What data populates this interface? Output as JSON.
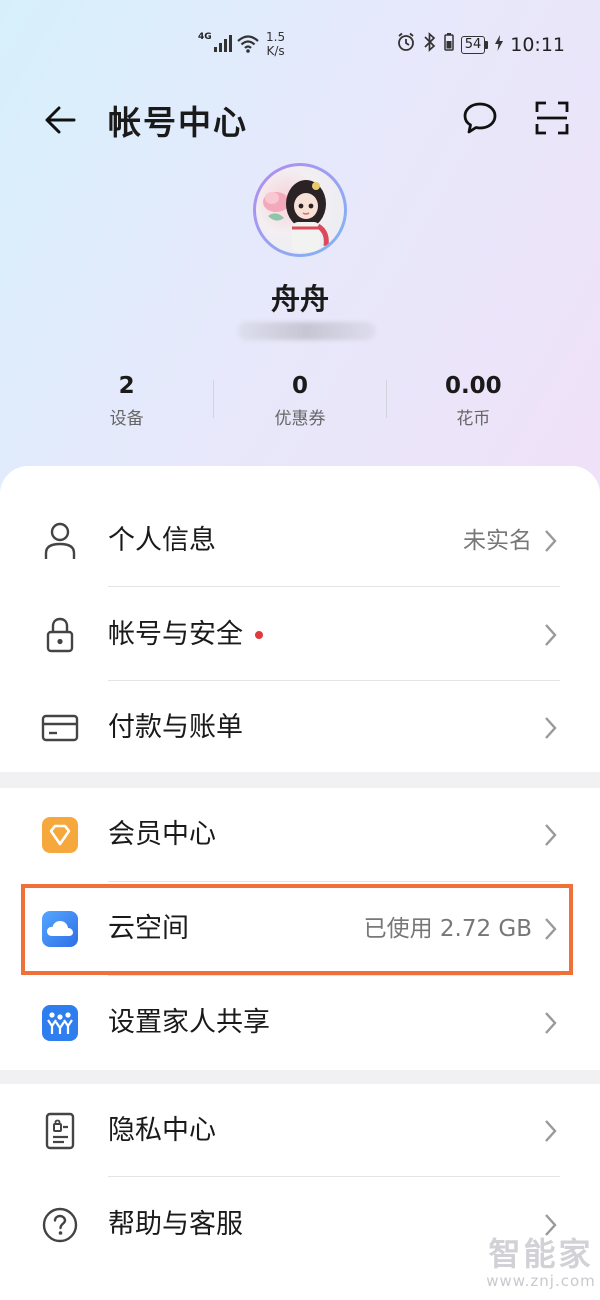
{
  "status_bar": {
    "network": "4G",
    "speed_value": "1.5",
    "speed_unit": "K/s",
    "battery": "54",
    "time": "10:11"
  },
  "header": {
    "title": "帐号中心",
    "icons": [
      "back-arrow-icon",
      "message-icon",
      "scan-icon"
    ]
  },
  "profile": {
    "name": "舟舟",
    "phone": "",
    "stats": [
      {
        "value": "2",
        "label": "设备"
      },
      {
        "value": "0",
        "label": "优惠券"
      },
      {
        "value": "0.00",
        "label": "花币"
      }
    ]
  },
  "sections": [
    {
      "items": [
        {
          "label": "个人信息",
          "value": "未实名",
          "icon": "person-icon"
        },
        {
          "label": "帐号与安全",
          "value": "",
          "icon": "lock-icon",
          "badge_color": "#e03a3a"
        },
        {
          "label": "付款与账单",
          "value": "",
          "icon": "card-icon"
        }
      ]
    },
    {
      "items": [
        {
          "label": "会员中心",
          "value": "",
          "icon": "vip-diamond-icon"
        },
        {
          "label": "云空间",
          "value": "已使用 2.72 GB",
          "icon": "cloud-icon"
        },
        {
          "label": "设置家人共享",
          "value": "",
          "icon": "family-share-icon"
        }
      ]
    },
    {
      "items": [
        {
          "label": "隐私中心",
          "value": "",
          "icon": "privacy-icon"
        },
        {
          "label": "帮助与客服",
          "value": "",
          "icon": "help-icon"
        }
      ]
    }
  ],
  "colors": {
    "highlight": "#f0703a",
    "vip_icon": "#f7a83c",
    "cloud_icon": "#3d8bf0",
    "family_icon": "#2f7ef0"
  },
  "watermark": {
    "title": "智能家",
    "url": "www.znj.com"
  }
}
